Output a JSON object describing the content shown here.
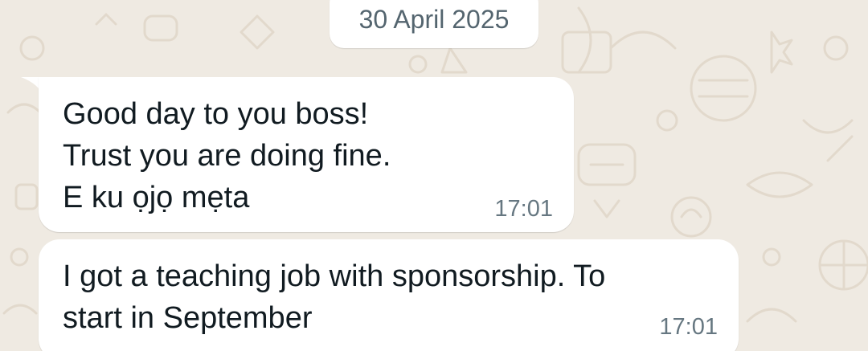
{
  "chat": {
    "date_separator": "30 April 2025",
    "messages": [
      {
        "direction": "incoming",
        "text": "Good day to you boss!\nTrust you are doing fine.\nE ku ọjọ mẹta",
        "time": "17:01"
      },
      {
        "direction": "incoming",
        "text": "I got a teaching job with sponsorship. To\nstart in September",
        "time": "17:01"
      }
    ]
  },
  "colors": {
    "wallpaper": "#efeae2",
    "doodle": "#e2d9cc",
    "bubble": "#ffffff",
    "text": "#111b21",
    "meta": "#667781",
    "date_text": "#54656f"
  }
}
